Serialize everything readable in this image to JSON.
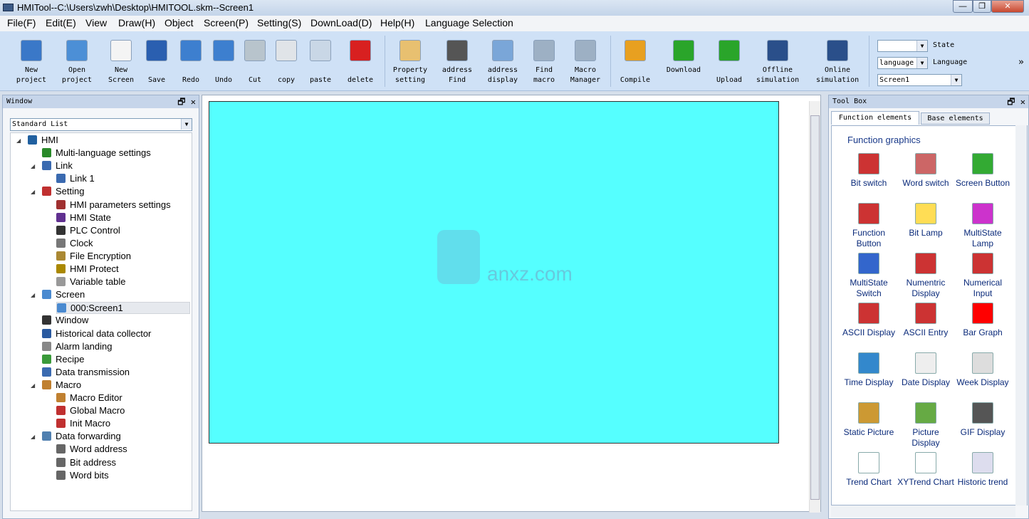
{
  "title": "HMITool--C:\\Users\\zwh\\Desktop\\HMITOOL.skm--Screen1",
  "menu": [
    "File(F)",
    "Edit(E)",
    "View",
    "Draw(H)",
    "Object",
    "Screen(P)",
    "Setting(S)",
    "DownLoad(D)",
    "Help(H)",
    "Language Selection"
  ],
  "toolbar": [
    {
      "l1": "New",
      "l2": "project",
      "icon": "new-project-icon",
      "color": "#3a78c8"
    },
    {
      "l1": "Open",
      "l2": "project",
      "icon": "open-project-icon",
      "color": "#4c8fd6"
    },
    {
      "l1": "New",
      "l2": "Screen",
      "icon": "new-screen-icon",
      "color": "#f4f4f4"
    },
    {
      "l1": "",
      "l2": "Save",
      "icon": "save-icon",
      "color": "#2a5fb0"
    },
    {
      "l1": "",
      "l2": "Redo",
      "icon": "redo-icon",
      "color": "#3d7fcf"
    },
    {
      "l1": "",
      "l2": "Undo",
      "icon": "undo-icon",
      "color": "#3d7fcf"
    },
    {
      "l1": "",
      "l2": "Cut",
      "icon": "cut-icon",
      "color": "#b8c4cc"
    },
    {
      "l1": "",
      "l2": "copy",
      "icon": "copy-icon",
      "color": "#e0e4e8"
    },
    {
      "l1": "",
      "l2": "paste",
      "icon": "paste-icon",
      "color": "#c9d7e6"
    },
    {
      "l1": "",
      "l2": "delete",
      "icon": "delete-icon",
      "color": "#d82020"
    },
    {
      "l1": "Property",
      "l2": "setting",
      "icon": "property-icon",
      "color": "#e8c070"
    },
    {
      "l1": "address",
      "l2": "Find",
      "icon": "binoculars-icon",
      "color": "#555"
    },
    {
      "l1": "address",
      "l2": "display",
      "icon": "address-display-icon",
      "color": "#7aa6d8"
    },
    {
      "l1": "Find",
      "l2": "macro",
      "icon": "find-macro-icon",
      "color": "#9db0c4"
    },
    {
      "l1": "Macro",
      "l2": "Manager",
      "icon": "macro-manager-icon",
      "color": "#9db0c4"
    },
    {
      "l1": "",
      "l2": "Compile",
      "icon": "hammer-icon",
      "color": "#e8a020"
    },
    {
      "l1": "Download",
      "l2": "",
      "icon": "download-icon",
      "color": "#2aa52a"
    },
    {
      "l1": "",
      "l2": "Upload",
      "icon": "upload-icon",
      "color": "#2aa52a"
    },
    {
      "l1": "Offline",
      "l2": "simulation",
      "icon": "offline-sim-icon",
      "color": "#2a4f8a"
    },
    {
      "l1": "Online",
      "l2": "simulation",
      "icon": "online-sim-icon",
      "color": "#2a4f8a"
    }
  ],
  "state_combo": {
    "value": "",
    "label": "State"
  },
  "language_combo": {
    "value": "language",
    "label": "Language"
  },
  "screen_combo": {
    "value": "Screen1"
  },
  "left_panel": {
    "title": "Window",
    "dropdown": "Standard List",
    "tree": [
      {
        "label": "HMI",
        "lvl": 0,
        "tw": true
      },
      {
        "label": "Multi-language settings",
        "lvl": 1
      },
      {
        "label": "Link",
        "lvl": 1,
        "tw": true
      },
      {
        "label": "Link 1",
        "lvl": 2
      },
      {
        "label": "Setting",
        "lvl": 1,
        "tw": true
      },
      {
        "label": "HMI parameters settings",
        "lvl": 2
      },
      {
        "label": "HMI State",
        "lvl": 2
      },
      {
        "label": "PLC Control",
        "lvl": 2
      },
      {
        "label": "Clock",
        "lvl": 2
      },
      {
        "label": "File Encryption",
        "lvl": 2
      },
      {
        "label": "HMI Protect",
        "lvl": 2
      },
      {
        "label": "Variable table",
        "lvl": 2
      },
      {
        "label": "Screen",
        "lvl": 1,
        "tw": true
      },
      {
        "label": "000:Screen1",
        "lvl": 2,
        "selected": true
      },
      {
        "label": "Window",
        "lvl": 1
      },
      {
        "label": "Historical data collector",
        "lvl": 1
      },
      {
        "label": "Alarm landing",
        "lvl": 1
      },
      {
        "label": "Recipe",
        "lvl": 1
      },
      {
        "label": "Data transmission",
        "lvl": 1
      },
      {
        "label": "Macro",
        "lvl": 1,
        "tw": true
      },
      {
        "label": "Macro Editor",
        "lvl": 2
      },
      {
        "label": "Global Macro",
        "lvl": 2
      },
      {
        "label": "Init Macro",
        "lvl": 2
      },
      {
        "label": "Data forwarding",
        "lvl": 1,
        "tw": true
      },
      {
        "label": "Word address",
        "lvl": 2
      },
      {
        "label": "Bit address",
        "lvl": 2
      },
      {
        "label": "Word bits",
        "lvl": 2
      }
    ]
  },
  "canvas": {
    "color": "#55ffff",
    "watermark": "anxz.com"
  },
  "toolbox": {
    "title": "Tool Box",
    "tabs": [
      "Function elements",
      "Base elements"
    ],
    "group": "Function graphics",
    "items": [
      {
        "label": "Bit switch",
        "c": "#c33"
      },
      {
        "label": "Word switch",
        "c": "#c66"
      },
      {
        "label": "Screen Button",
        "c": "#3a3"
      },
      {
        "label": "Function Button",
        "c": "#c33"
      },
      {
        "label": "Bit Lamp",
        "c": "#fd5"
      },
      {
        "label": "MultiState Lamp",
        "c": "#c3c"
      },
      {
        "label": "MultiState Switch",
        "c": "#36c"
      },
      {
        "label": "Numentric Display",
        "c": "#c33"
      },
      {
        "label": "Numerical Input",
        "c": "#c33"
      },
      {
        "label": "ASCII Display",
        "c": "#c33"
      },
      {
        "label": "ASCII Entry",
        "c": "#c33"
      },
      {
        "label": "Bar Graph",
        "c": "#f00"
      },
      {
        "label": "Time Display",
        "c": "#38c"
      },
      {
        "label": "Date Display",
        "c": "#eee"
      },
      {
        "label": "Week Display",
        "c": "#ddd"
      },
      {
        "label": "Static Picture",
        "c": "#c93"
      },
      {
        "label": "Picture Display",
        "c": "#6a4"
      },
      {
        "label": "GIF Display",
        "c": "#555"
      },
      {
        "label": "Trend Chart",
        "c": "#fff"
      },
      {
        "label": "XYTrend Chart",
        "c": "#fff"
      },
      {
        "label": "Historic trend",
        "c": "#dde"
      }
    ]
  }
}
